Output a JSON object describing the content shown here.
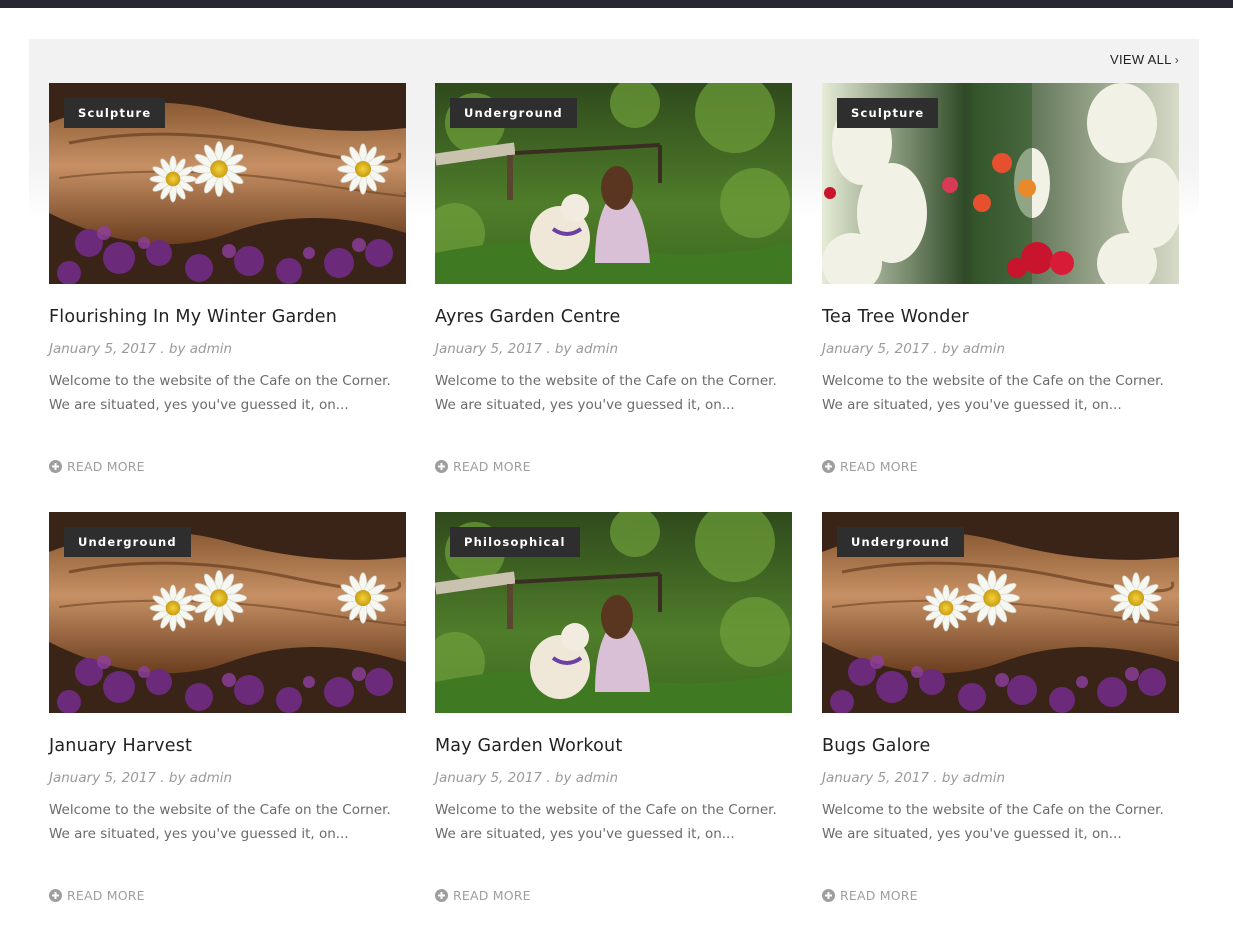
{
  "header": {
    "view_all_label": "VIEW ALL",
    "view_all_icon": "chevron-right-icon"
  },
  "posts": [
    {
      "category": "Sculpture",
      "title": "Flourishing In My Winter Garden",
      "meta": "January 5, 2017 . by admin",
      "excerpt": "Welcome to the website of the Cafe on the Corner. We are situated, yes you've guessed it, on...",
      "read_more": "READ MORE",
      "image": "daisies-on-bark"
    },
    {
      "category": "Underground",
      "title": "Ayres Garden Centre",
      "meta": "January 5, 2017 . by admin",
      "excerpt": "Welcome to the website of the Cafe on the Corner. We are situated, yes you've guessed it, on...",
      "read_more": "READ MORE",
      "image": "girl-with-dog-in-garden"
    },
    {
      "category": "Sculpture",
      "title": "Tea Tree Wonder",
      "meta": "January 5, 2017 . by admin",
      "excerpt": "Welcome to the website of the Cafe on the Corner. We are situated, yes you've guessed it, on...",
      "read_more": "READ MORE",
      "image": "flower-bed"
    },
    {
      "category": "Underground",
      "title": "January Harvest",
      "meta": "January 5, 2017 . by admin",
      "excerpt": "Welcome to the website of the Cafe on the Corner. We are situated, yes you've guessed it, on...",
      "read_more": "READ MORE",
      "image": "daisies-on-bark"
    },
    {
      "category": "Philosophical",
      "title": "May Garden Workout",
      "meta": "January 5, 2017 . by admin",
      "excerpt": "Welcome to the website of the Cafe on the Corner. We are situated, yes you've guessed it, on...",
      "read_more": "READ MORE",
      "image": "girl-with-dog-in-garden"
    },
    {
      "category": "Underground",
      "title": "Bugs Galore",
      "meta": "January 5, 2017 . by admin",
      "excerpt": "Welcome to the website of the Cafe on the Corner. We are situated, yes you've guessed it, on...",
      "read_more": "READ MORE",
      "image": "daisies-on-bark"
    }
  ],
  "colors": {
    "topbar": "#262833",
    "badge_bg": "#2e2e2e",
    "title": "#222222",
    "meta": "#9a9a9a",
    "excerpt": "#6a6a6a",
    "read_more": "#9e9e9e"
  }
}
